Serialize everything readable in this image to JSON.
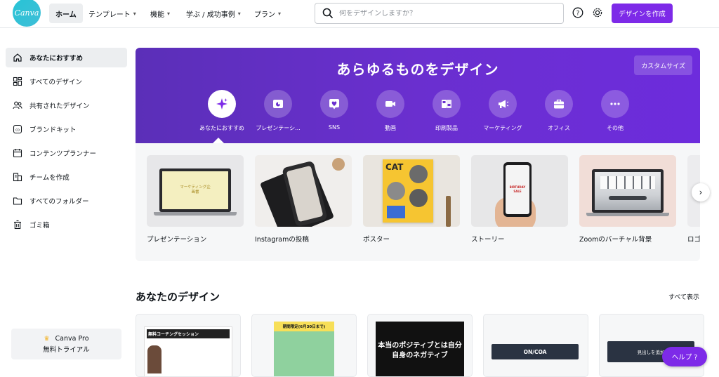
{
  "app": {
    "logo_text": "Canva",
    "brand_color": "#7d2ae8",
    "logo_color": "#27c4d6"
  },
  "nav": {
    "home": "ホーム",
    "items": [
      "テンプレート",
      "機能",
      "学ぶ / 成功事例",
      "プラン"
    ]
  },
  "search": {
    "placeholder": "何をデザインしますか？",
    "value": ""
  },
  "header": {
    "create_button": "デザインを作成",
    "help_icon": "help-icon",
    "settings_icon": "gear-icon"
  },
  "sidebar": {
    "items": [
      {
        "label": "あなたにおすすめ",
        "icon": "home-icon",
        "active": true
      },
      {
        "label": "すべてのデザイン",
        "icon": "grid-icon",
        "active": false
      },
      {
        "label": "共有されたデザイン",
        "icon": "people-icon",
        "active": false
      },
      {
        "label": "ブランドキット",
        "icon": "brand-kit-icon",
        "active": false
      },
      {
        "label": "コンテンツプランナー",
        "icon": "calendar-icon",
        "active": false
      },
      {
        "label": "チームを作成",
        "icon": "team-icon",
        "active": false
      },
      {
        "label": "すべてのフォルダー",
        "icon": "folder-icon",
        "active": false
      },
      {
        "label": "ゴミ箱",
        "icon": "trash-icon",
        "active": false
      }
    ],
    "pro": {
      "title": "Canva Pro",
      "subtitle": "無料トライアル",
      "icon": "crown-icon"
    }
  },
  "hero": {
    "title": "あらゆるものをデザイン",
    "custom_size": "カスタムサイズ",
    "categories": [
      {
        "label": "あなたにおすすめ",
        "icon": "sparkle-icon",
        "active": true
      },
      {
        "label": "プレゼンテーシ...",
        "icon": "presentation-icon",
        "active": false
      },
      {
        "label": "SNS",
        "icon": "heart-icon",
        "active": false
      },
      {
        "label": "動画",
        "icon": "video-icon",
        "active": false
      },
      {
        "label": "印刷製品",
        "icon": "print-icon",
        "active": false
      },
      {
        "label": "マーケティング",
        "icon": "megaphone-icon",
        "active": false
      },
      {
        "label": "オフィス",
        "icon": "briefcase-icon",
        "active": false
      },
      {
        "label": "その他",
        "icon": "more-icon",
        "active": false
      }
    ]
  },
  "templates": [
    {
      "label": "プレゼンテーション",
      "thumb_text": "マーケティング企画書"
    },
    {
      "label": "Instagramの投稿",
      "thumb_text": ""
    },
    {
      "label": "ポスター",
      "thumb_text": "CAT"
    },
    {
      "label": "ストーリー",
      "thumb_text": "BIRTHDAY SALE"
    },
    {
      "label": "Zoomのバーチャル背景",
      "thumb_text": ""
    },
    {
      "label": "ロゴ",
      "thumb_text": ""
    }
  ],
  "designs": {
    "title": "あなたのデザイン",
    "see_all": "すべて表示",
    "items": [
      {
        "text": "無料コーチングセッション"
      },
      {
        "text": "期間限定(6月30日まで)"
      },
      {
        "text": "本当のポジティブとは自分自身のネガティブ"
      },
      {
        "text": "ON/COA"
      },
      {
        "text": "見出しを追加"
      }
    ]
  },
  "help": {
    "label": "ヘルプ ?"
  }
}
